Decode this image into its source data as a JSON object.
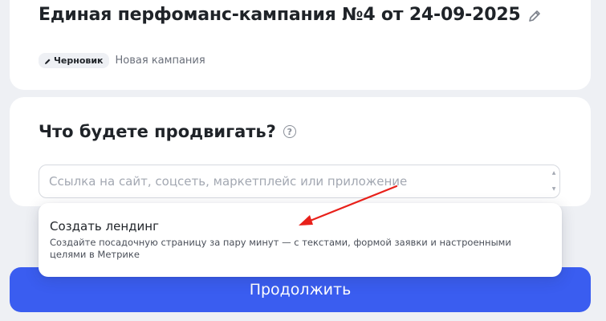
{
  "header": {
    "title": "Единая перфоманс-кампания №4 от 24-09-2025",
    "edit_icon": "pencil-icon",
    "badge_label": "Черновик",
    "badge_icon": "pencil-icon",
    "status_text": "Новая кампания"
  },
  "section": {
    "title": "Что будете продвигать?",
    "help_icon": "question-circle-icon",
    "input_placeholder": "Ссылка на сайт, соцсеть, маркетплейс или приложение",
    "input_value": ""
  },
  "dropdown": {
    "items": [
      {
        "title": "Создать лендинг",
        "description": "Создайте посадочную страницу за пару минут — с текстами, формой заявки и настроенными целями в Метрике"
      }
    ]
  },
  "footer": {
    "continue_label": "Продолжить"
  },
  "colors": {
    "accent": "#3a5df0",
    "background": "#eef0f4",
    "annotation_arrow": "#e8201a"
  }
}
